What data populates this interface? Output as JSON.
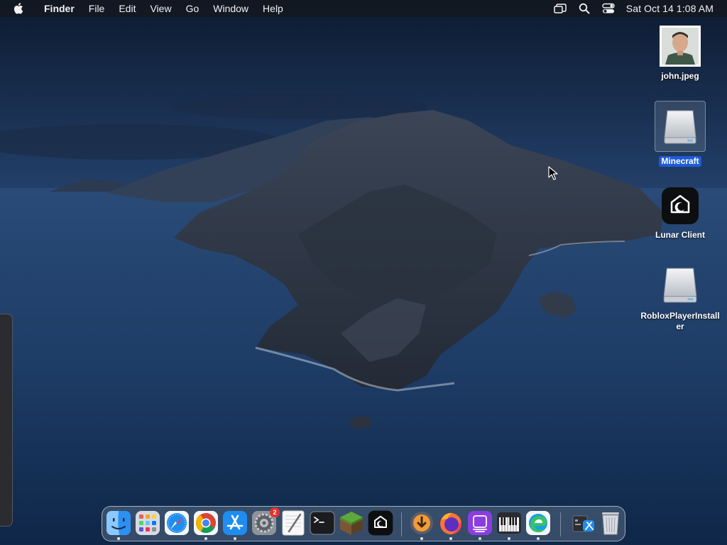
{
  "menubar": {
    "app_name": "Finder",
    "menus": [
      "File",
      "Edit",
      "View",
      "Go",
      "Window",
      "Help"
    ],
    "clock": "Sat Oct 14  1:08 AM"
  },
  "desktop_icons": [
    {
      "label": "john.jpeg",
      "icon": "photo-thumbnail-icon"
    },
    {
      "label": "Minecraft",
      "icon": "disk-image-icon",
      "selected": true
    },
    {
      "label": "Lunar Client",
      "icon": "lunar-client-icon"
    },
    {
      "label": "RobloxPlayerInstaller",
      "icon": "disk-image-icon"
    }
  ],
  "dock": {
    "items": [
      {
        "name": "finder",
        "icon": "finder-icon",
        "running": true
      },
      {
        "name": "launchpad",
        "icon": "launchpad-icon",
        "running": false
      },
      {
        "name": "safari",
        "icon": "safari-icon",
        "running": false
      },
      {
        "name": "chrome",
        "icon": "chrome-icon",
        "running": true
      },
      {
        "name": "app-store",
        "icon": "app-store-icon",
        "running": true
      },
      {
        "name": "system-preferences",
        "icon": "gear-icon",
        "running": false,
        "badge": "2"
      },
      {
        "name": "textedit",
        "icon": "textedit-icon",
        "running": false
      },
      {
        "name": "terminal",
        "icon": "terminal-icon",
        "running": false
      },
      {
        "name": "minecraft",
        "icon": "minecraft-icon",
        "running": false
      },
      {
        "name": "lunar-client",
        "icon": "lunar-client-icon",
        "running": false
      },
      {
        "name": "downloads-installer",
        "icon": "download-icon",
        "running": true
      },
      {
        "name": "firefox",
        "icon": "firefox-icon",
        "running": true
      },
      {
        "name": "podcast-app",
        "icon": "purple-app-icon",
        "running": true
      },
      {
        "name": "piano-app",
        "icon": "piano-icon",
        "running": true
      },
      {
        "name": "edge",
        "icon": "edge-icon",
        "running": true
      },
      {
        "name": "downloads-stack",
        "icon": "stack-icon",
        "running": false
      },
      {
        "name": "trash",
        "icon": "trash-icon",
        "running": false
      }
    ],
    "badge_color": "#e5322e"
  },
  "colors": {
    "selection": "#1f5bd6",
    "menubar_bg": "#14181f"
  }
}
